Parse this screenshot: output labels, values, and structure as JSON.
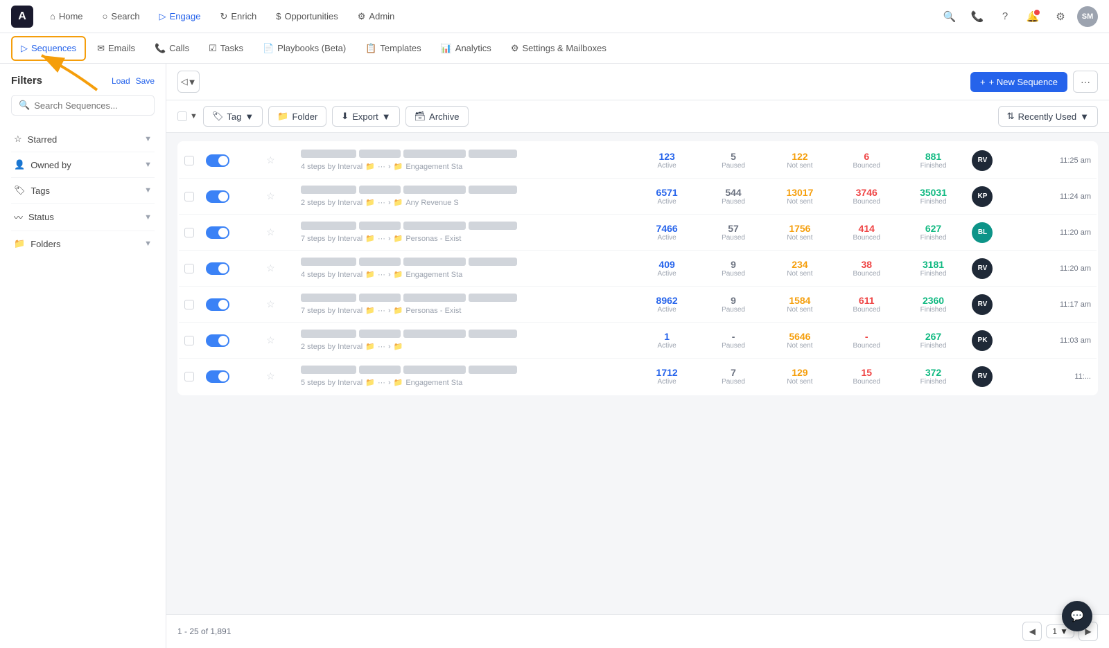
{
  "app": {
    "logo": "A",
    "nav": {
      "items": [
        {
          "label": "Home",
          "icon": "home",
          "active": false
        },
        {
          "label": "Search",
          "icon": "search",
          "active": false
        },
        {
          "label": "Engage",
          "icon": "engage",
          "active": true
        },
        {
          "label": "Enrich",
          "icon": "enrich",
          "active": false
        },
        {
          "label": "Opportunities",
          "icon": "dollar",
          "active": false
        },
        {
          "label": "Admin",
          "icon": "admin",
          "active": false
        }
      ],
      "avatar": "SM"
    },
    "subnav": {
      "items": [
        {
          "label": "Sequences",
          "icon": "sequences",
          "active": true
        },
        {
          "label": "Emails",
          "icon": "emails",
          "active": false
        },
        {
          "label": "Calls",
          "icon": "calls",
          "active": false
        },
        {
          "label": "Tasks",
          "icon": "tasks",
          "active": false
        },
        {
          "label": "Playbooks (Beta)",
          "icon": "playbooks",
          "active": false
        },
        {
          "label": "Templates",
          "icon": "templates",
          "active": false
        },
        {
          "label": "Analytics",
          "icon": "analytics",
          "active": false
        },
        {
          "label": "Settings & Mailboxes",
          "icon": "settings",
          "active": false
        }
      ]
    }
  },
  "sidebar": {
    "title": "Filters",
    "load_label": "Load",
    "save_label": "Save",
    "search_placeholder": "Search Sequences...",
    "groups": [
      {
        "label": "Starred",
        "icon": "star"
      },
      {
        "label": "Owned by",
        "icon": "user"
      },
      {
        "label": "Tags",
        "icon": "tag"
      },
      {
        "label": "Status",
        "icon": "status"
      },
      {
        "label": "Folders",
        "icon": "folder"
      }
    ]
  },
  "toolbar": {
    "new_sequence_label": "+ New Sequence",
    "tag_label": "Tag",
    "folder_label": "Folder",
    "export_label": "Export",
    "archive_label": "Archive",
    "recently_used_label": "Recently Used",
    "sort_icon": "⇅"
  },
  "sequences": {
    "rows": [
      {
        "id": 1,
        "active": true,
        "starred": false,
        "name": "████████ ████ ████████ ████████████",
        "meta": "4 steps by Interval",
        "folder": "Engagement Sta",
        "active_count": "123",
        "paused_count": "5",
        "not_sent_count": "122",
        "bounced_count": "6",
        "finished_count": "881",
        "avatar_initials": "RV",
        "avatar_color": "dark",
        "time": "11:25 am"
      },
      {
        "id": 2,
        "active": true,
        "starred": false,
        "name": "████████ ████████ ████████████",
        "meta": "2 steps by Interval",
        "folder": "Any Revenue S",
        "active_count": "6571",
        "paused_count": "544",
        "not_sent_count": "13017",
        "bounced_count": "3746",
        "finished_count": "35031",
        "avatar_initials": "KP",
        "avatar_color": "dark",
        "time": "11:24 am"
      },
      {
        "id": 3,
        "active": true,
        "starred": false,
        "name": "████████ ████████ ████ ████████",
        "meta": "7 steps by Interval",
        "folder": "Personas - Exist",
        "active_count": "7466",
        "paused_count": "57",
        "not_sent_count": "1756",
        "bounced_count": "414",
        "finished_count": "627",
        "avatar_initials": "BL",
        "avatar_color": "teal",
        "time": "11:20 am"
      },
      {
        "id": 4,
        "active": true,
        "starred": false,
        "name": "████████ ████████████ ████ ████ ████████████",
        "meta": "4 steps by Interval",
        "folder": "Engagement Sta",
        "active_count": "409",
        "paused_count": "9",
        "not_sent_count": "234",
        "bounced_count": "38",
        "finished_count": "3181",
        "avatar_initials": "RV",
        "avatar_color": "dark",
        "time": "11:20 am"
      },
      {
        "id": 5,
        "active": true,
        "starred": false,
        "name": "████████ ████ ████████████ ████ ████████",
        "meta": "7 steps by Interval",
        "folder": "Personas - Exist",
        "active_count": "8962",
        "paused_count": "9",
        "not_sent_count": "1584",
        "bounced_count": "611",
        "finished_count": "2360",
        "avatar_initials": "RV",
        "avatar_color": "dark",
        "time": "11:17 am"
      },
      {
        "id": 6,
        "active": true,
        "starred": false,
        "name": "████████ ████████████ ████████",
        "meta": "2 steps by Interval",
        "folder": "",
        "active_count": "1",
        "paused_count": "-",
        "not_sent_count": "5646",
        "bounced_count": "-",
        "finished_count": "267",
        "avatar_initials": "PK",
        "avatar_color": "dark",
        "time": "11:03 am"
      },
      {
        "id": 7,
        "active": true,
        "starred": false,
        "name": "████████ ████ ████████ ████████████ ████",
        "meta": "5 steps by Interval",
        "folder": "Engagement Sta",
        "active_count": "1712",
        "paused_count": "7",
        "not_sent_count": "129",
        "bounced_count": "15",
        "finished_count": "372",
        "avatar_initials": "RV",
        "avatar_color": "dark",
        "time": "11:..."
      }
    ],
    "pagination": {
      "range": "1 - 25 of 1,891",
      "current_page": "1"
    }
  },
  "column_headers": {
    "active": "Active",
    "paused": "Paused",
    "not_sent": "Not sent",
    "bounced": "Bounced",
    "finished": "Finished"
  }
}
